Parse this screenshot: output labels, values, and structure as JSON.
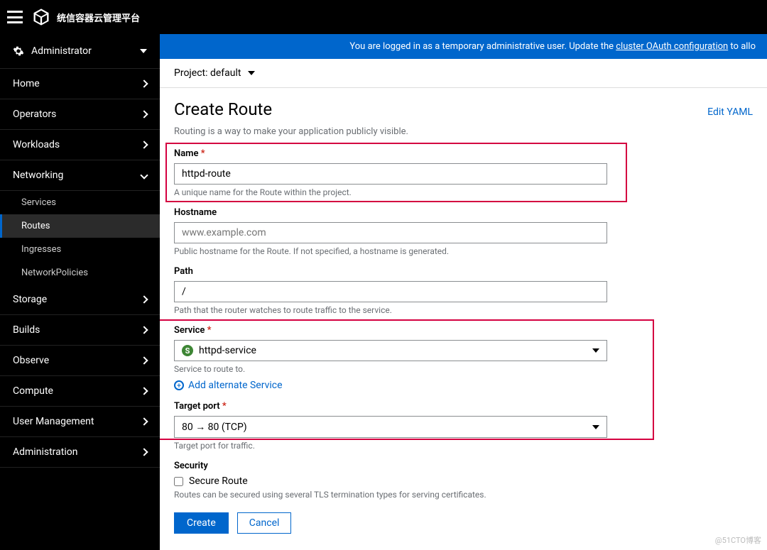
{
  "brand": "统信容器云管理平台",
  "banner": {
    "prefix": "You are logged in as a temporary administrative user. Update the ",
    "link": "cluster OAuth configuration",
    "suffix": " to allo"
  },
  "perspective": {
    "label": "Administrator"
  },
  "nav": {
    "home": "Home",
    "operators": "Operators",
    "workloads": "Workloads",
    "networking": "Networking",
    "services": "Services",
    "routes": "Routes",
    "ingresses": "Ingresses",
    "networkpolicies": "NetworkPolicies",
    "storage": "Storage",
    "builds": "Builds",
    "observe": "Observe",
    "compute": "Compute",
    "usermgmt": "User Management",
    "admin": "Administration"
  },
  "project": {
    "label": "Project: default"
  },
  "page": {
    "title": "Create Route",
    "yaml": "Edit YAML",
    "subtitle": "Routing is a way to make your application publicly visible."
  },
  "fields": {
    "name_label": "Name",
    "name_value": "httpd-route",
    "name_help": "A unique name for the Route within the project.",
    "host_label": "Hostname",
    "host_placeholder": "www.example.com",
    "host_help": "Public hostname for the Route. If not specified, a hostname is generated.",
    "path_label": "Path",
    "path_value": "/",
    "path_help": "Path that the router watches to route traffic to the service.",
    "service_label": "Service",
    "service_value": "httpd-service",
    "service_badge": "S",
    "service_help": "Service to route to.",
    "alt_service": "Add alternate Service",
    "port_label": "Target port",
    "port_value": "80 → 80 (TCP)",
    "port_help": "Target port for traffic.",
    "security_label": "Security",
    "secure_route": "Secure Route",
    "security_help": "Routes can be secured using several TLS termination types for serving certificates."
  },
  "buttons": {
    "create": "Create",
    "cancel": "Cancel"
  },
  "watermark": "@51CTO博客"
}
